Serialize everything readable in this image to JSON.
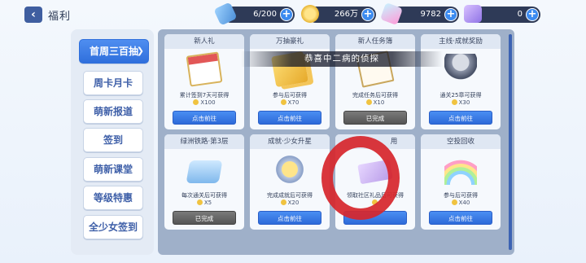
{
  "header": {
    "back_icon": "chevron-left-icon",
    "title": "福利"
  },
  "resources": [
    {
      "icon": "ticket-icon",
      "value": "6/200"
    },
    {
      "icon": "coin-icon",
      "value": "266万"
    },
    {
      "icon": "gem-icon",
      "value": "9782"
    },
    {
      "icon": "card-icon",
      "value": "0"
    }
  ],
  "sidebar": {
    "items": [
      {
        "label": "首周三百抽",
        "active": true
      },
      {
        "label": "周卡月卡"
      },
      {
        "label": "萌新报道"
      },
      {
        "label": "签到"
      },
      {
        "label": "萌新课堂"
      },
      {
        "label": "等级特惠"
      },
      {
        "label": "全少女签到"
      }
    ]
  },
  "banner": {
    "text": "恭喜中二病的侦探"
  },
  "cards": [
    {
      "title": "新人礼",
      "desc": "累计签到7天可获得",
      "reward": "X100",
      "button": "点击前往",
      "state": "go",
      "art": "calendar"
    },
    {
      "title": "万抽豪礼",
      "desc": "参与后可获得",
      "reward": "X70",
      "button": "点击前往",
      "state": "go",
      "art": "tickets"
    },
    {
      "title": "新人任务簿",
      "desc": "完成任务后可获得",
      "reward": "X10",
      "button": "已完成",
      "state": "done",
      "art": "paper"
    },
    {
      "title": "主线·成就奖励",
      "desc": "通关25章可获得",
      "reward": "X30",
      "button": "点击前往",
      "state": "go",
      "art": "char"
    },
    {
      "title": "绿洲铁路·第3层",
      "desc": "每次通关后可获得",
      "reward": "X5",
      "button": "已完成",
      "state": "done",
      "art": "train"
    },
    {
      "title": "成就·少女升星",
      "desc": "完成成就后可获得",
      "reward": "X20",
      "button": "点击前往",
      "state": "go",
      "art": "medal"
    },
    {
      "title": "用",
      "desc": "领取社区礼品后可获得",
      "reward": "",
      "button": "",
      "state": "go",
      "art": "giftcard"
    },
    {
      "title": "空投回收",
      "desc": "参与后可获得",
      "reward": "X40",
      "button": "点击前往",
      "state": "go",
      "art": "rainbow"
    }
  ]
}
